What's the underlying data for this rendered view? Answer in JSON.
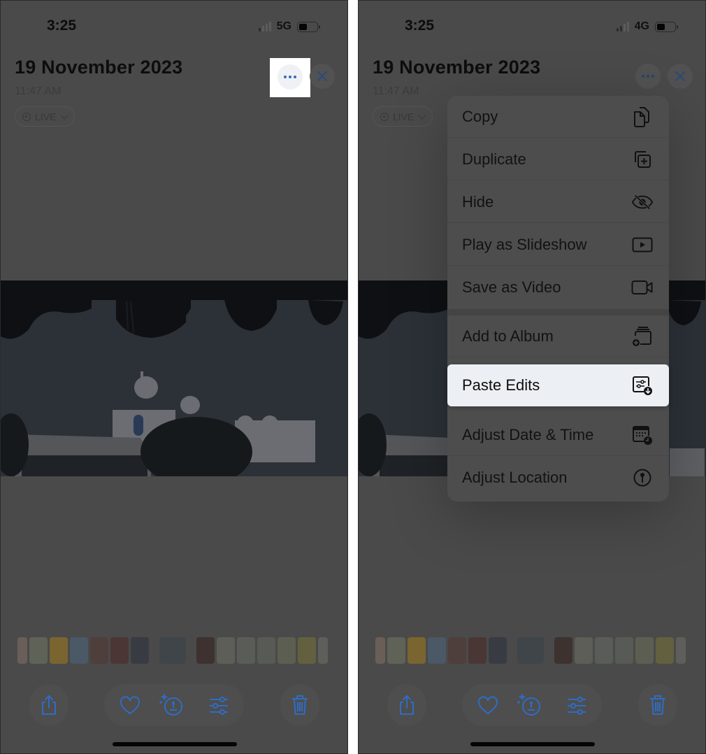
{
  "panels": [
    {
      "status": {
        "time": "3:25",
        "network": "5G"
      },
      "header": {
        "title": "19 November 2023",
        "time": "11:47 AM",
        "live_label": "LIVE"
      }
    },
    {
      "status": {
        "time": "3:25",
        "network": "4G"
      },
      "header": {
        "title": "19 November 2023",
        "time": "11:47 AM",
        "live_label": "LIVE"
      },
      "menu": {
        "items": [
          {
            "label": "Copy",
            "icon": "copy-icon"
          },
          {
            "label": "Duplicate",
            "icon": "duplicate-icon"
          },
          {
            "label": "Hide",
            "icon": "eye-slash-icon"
          },
          {
            "label": "Play as Slideshow",
            "icon": "play-rectangle-icon"
          },
          {
            "label": "Save as Video",
            "icon": "video-camera-icon"
          },
          {
            "label": "Add to Album",
            "icon": "add-to-album-icon"
          },
          {
            "label": "Paste Edits",
            "icon": "paste-edits-icon",
            "highlighted": true
          },
          {
            "label": "Adjust Date & Time",
            "icon": "calendar-clock-icon"
          },
          {
            "label": "Adjust Location",
            "icon": "location-pin-icon"
          }
        ]
      }
    }
  ],
  "toolbar": {
    "buttons": [
      "share-icon",
      "heart-icon",
      "visual-lookup-icon",
      "adjust-sliders-icon",
      "trash-icon"
    ]
  },
  "colors": {
    "accent": "#2f6cc4",
    "dim_overlay_bg": "#4a4a4a",
    "highlight_bg": "#eceff3"
  }
}
